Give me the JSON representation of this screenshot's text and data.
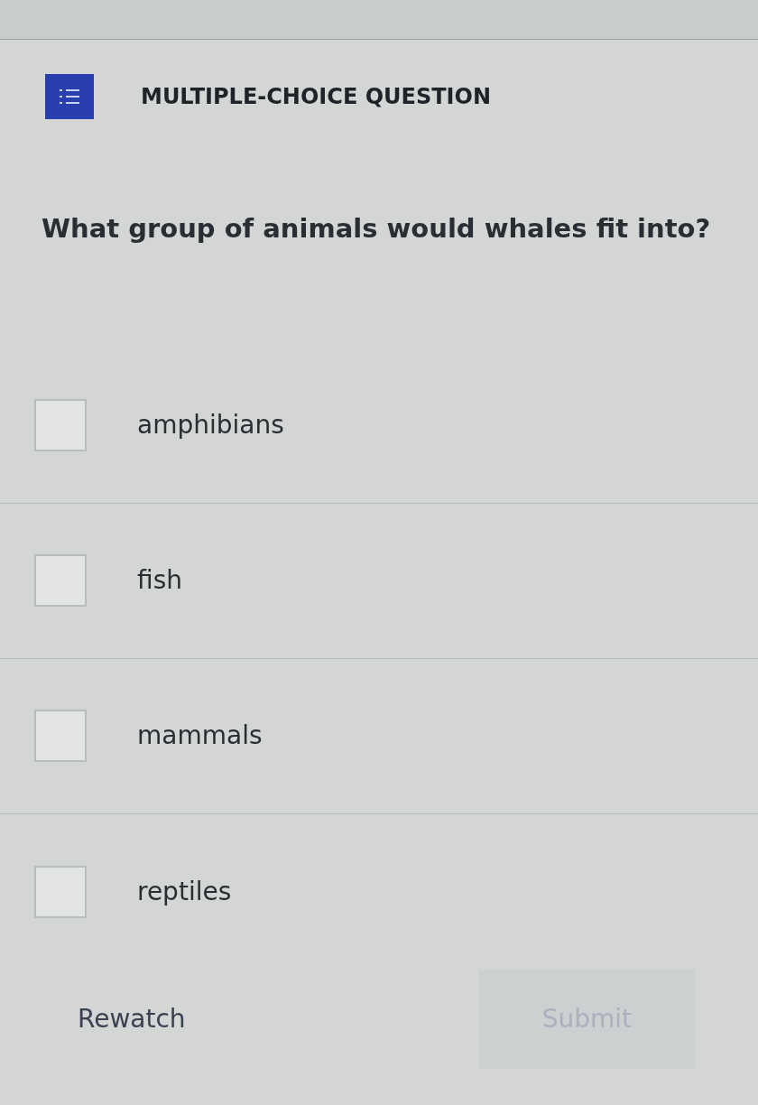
{
  "header": {
    "title": "MULTIPLE-CHOICE QUESTION"
  },
  "question": "What group of animals would whales fit into?",
  "options": [
    {
      "label": "amphibians",
      "checked": false
    },
    {
      "label": "fish",
      "checked": false
    },
    {
      "label": "mammals",
      "checked": false
    },
    {
      "label": "reptiles",
      "checked": false
    }
  ],
  "buttons": {
    "rewatch": {
      "label": "Rewatch"
    },
    "submit": {
      "label": "Submit",
      "disabled": true
    }
  }
}
